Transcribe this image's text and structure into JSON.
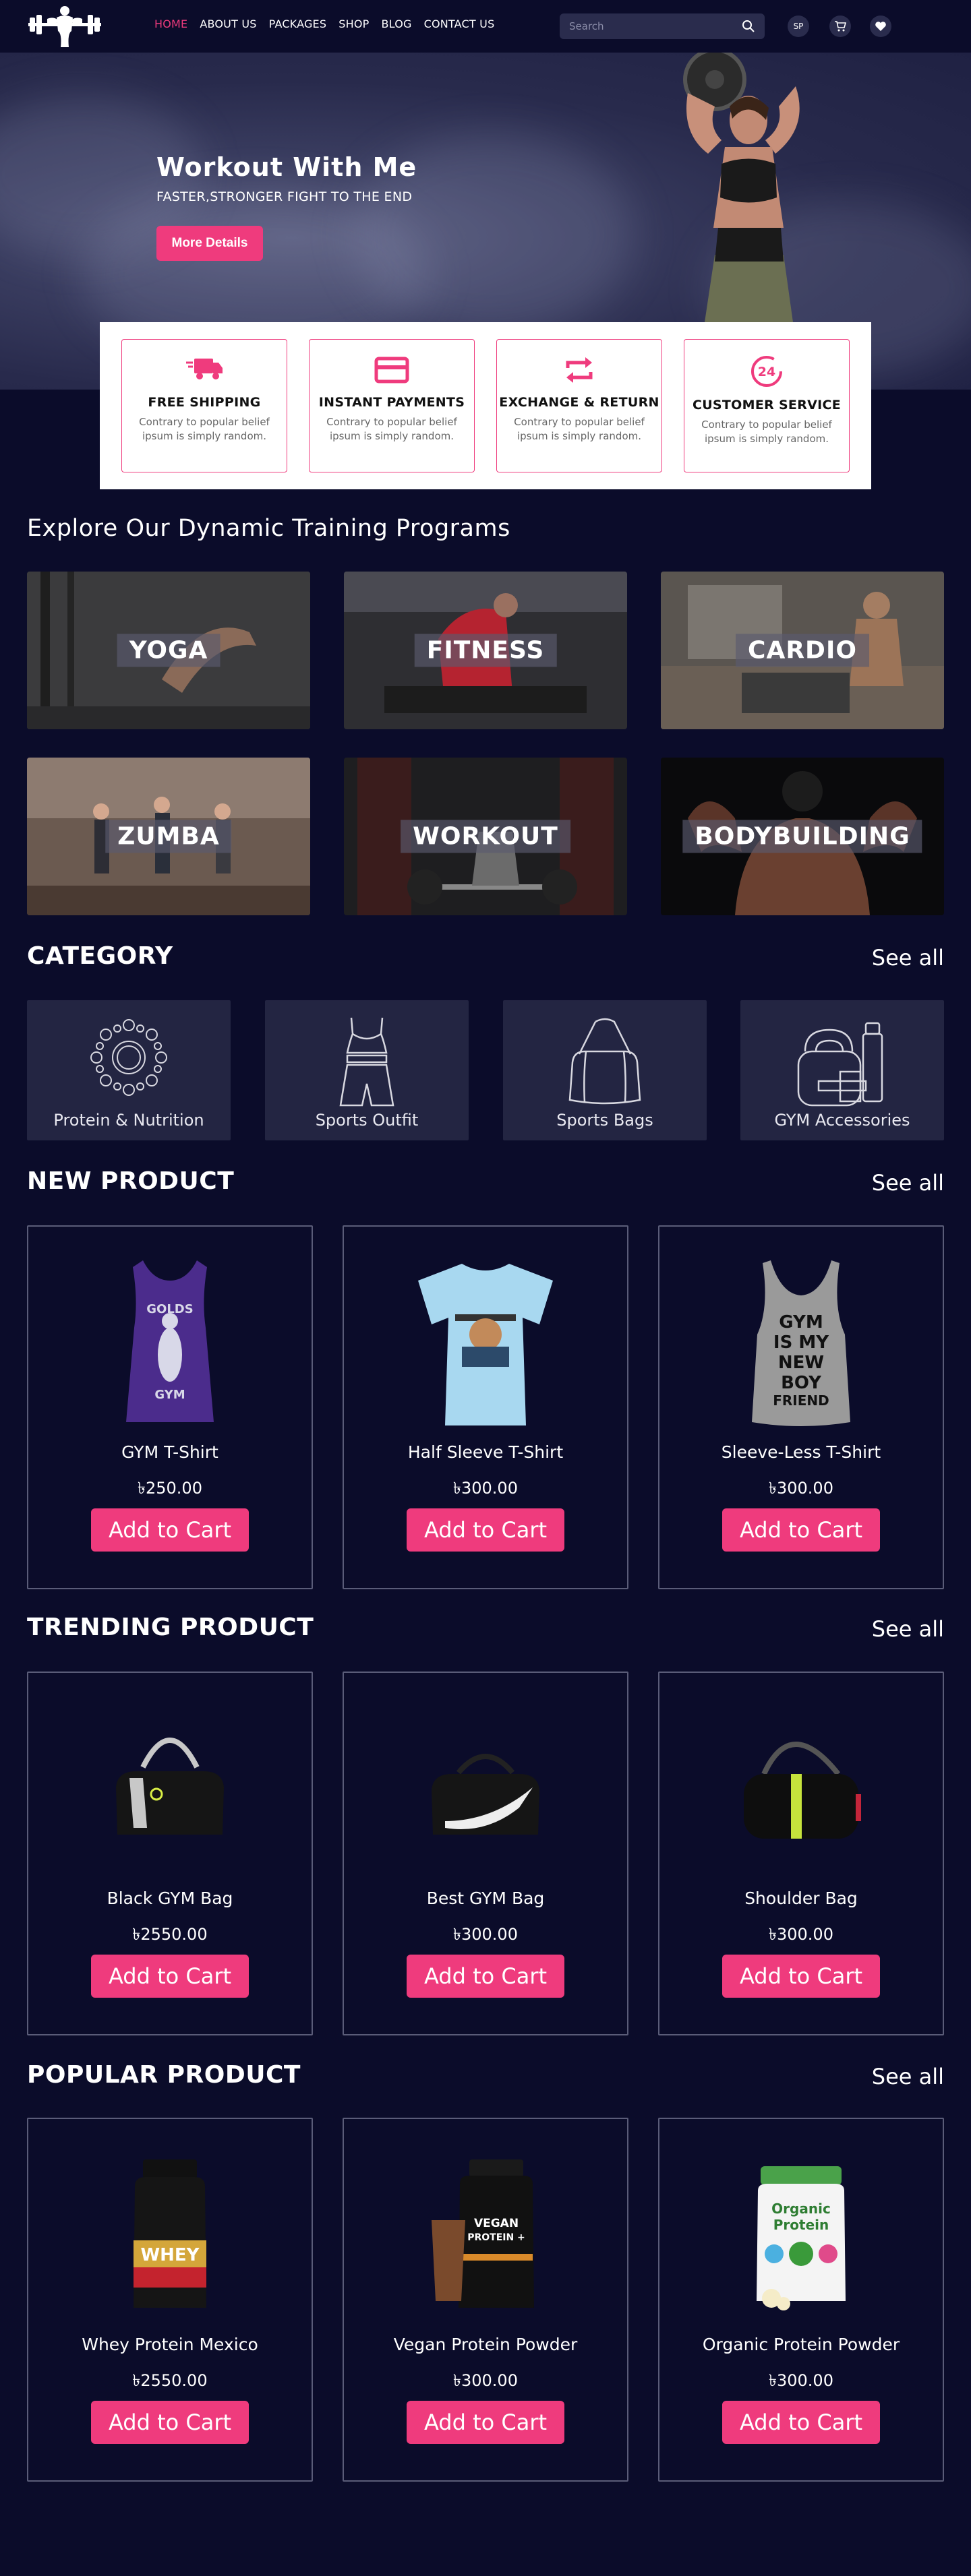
{
  "header": {
    "nav": [
      "HOME",
      "ABOUT US",
      "PACKAGES",
      "SHOP",
      "BLOG",
      "CONTACT US"
    ],
    "search_placeholder": "Search",
    "profile_initials": "SP"
  },
  "hero": {
    "title": "Workout With Me",
    "subtitle": "FASTER,STRONGER FIGHT TO THE END",
    "button": "More Details"
  },
  "features": [
    {
      "title": "FREE SHIPPING",
      "desc": "Contrary to popular belief ipsum is simply random.",
      "icon": "truck-icon"
    },
    {
      "title": "INSTANT PAYMENTS",
      "desc": "Contrary to popular belief ipsum is simply random.",
      "icon": "card-icon"
    },
    {
      "title": "EXCHANGE & RETURN",
      "desc": "Contrary to popular belief ipsum is simply random.",
      "icon": "exchange-icon"
    },
    {
      "title": "CUSTOMER SERVICE",
      "desc": "Contrary to popular belief ipsum is simply random.",
      "icon": "support-24-icon"
    }
  ],
  "programs": {
    "title": "Explore Our Dynamic Training Programs",
    "items": [
      "YOGA",
      "FITNESS",
      "CARDIO",
      "ZUMBA",
      "WORKOUT",
      "BODYBUILDING"
    ]
  },
  "category": {
    "title": "CATEGORY",
    "see_all": "See all",
    "items": [
      "Protein & Nutrition",
      "Sports Outfit",
      "Sports Bags",
      "GYM Accessories"
    ]
  },
  "new_product": {
    "title": "NEW PRODUCT",
    "see_all": "See all",
    "items": [
      {
        "name": "GYM T-Shirt",
        "price": "৳250.00",
        "button": "Add to Cart"
      },
      {
        "name": "Half Sleeve T-Shirt",
        "price": "৳300.00",
        "button": "Add to Cart"
      },
      {
        "name": "Sleeve-Less T-Shirt",
        "price": "৳300.00",
        "button": "Add to Cart"
      }
    ]
  },
  "trending_product": {
    "title": "TRENDING PRODUCT",
    "see_all": "See all",
    "items": [
      {
        "name": "Black GYM Bag",
        "price": "৳2550.00",
        "button": "Add to Cart"
      },
      {
        "name": "Best GYM Bag",
        "price": "৳300.00",
        "button": "Add to Cart"
      },
      {
        "name": "Shoulder Bag",
        "price": "৳300.00",
        "button": "Add to Cart"
      }
    ]
  },
  "popular_product": {
    "title": "POPULAR PRODUCT",
    "see_all": "See all",
    "items": [
      {
        "name": "Whey Protein Mexico",
        "price": "৳2550.00",
        "button": "Add to Cart"
      },
      {
        "name": "Vegan Protein Powder",
        "price": "৳300.00",
        "button": "Add to Cart"
      },
      {
        "name": "Organic Protein Powder",
        "price": "৳300.00",
        "button": "Add to Cart"
      }
    ]
  },
  "colors": {
    "accent": "#ef3b7d",
    "background": "#0b0c2a",
    "card": "#232542"
  }
}
